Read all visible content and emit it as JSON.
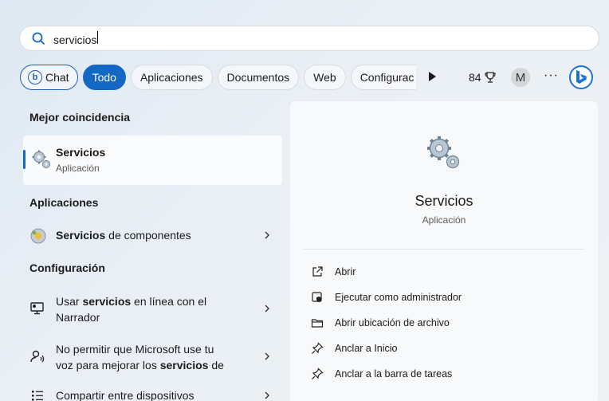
{
  "search": {
    "value": "servicios"
  },
  "filters": [
    {
      "label": "Chat"
    },
    {
      "label": "Todo"
    },
    {
      "label": "Aplicaciones"
    },
    {
      "label": "Documentos"
    },
    {
      "label": "Web"
    },
    {
      "label": "Configurac"
    }
  ],
  "toolbar": {
    "points": "84",
    "avatar_initial": "M",
    "more": "···"
  },
  "left": {
    "best_match_title": "Mejor coincidencia",
    "best": {
      "name": "Servicios",
      "type": "Aplicación"
    },
    "apps_title": "Aplicaciones",
    "app_item": {
      "bold": "Servicios",
      "rest": " de componentes"
    },
    "config_title": "Configuración",
    "config_items": [
      {
        "pre": "Usar ",
        "bold": "servicios",
        "post": " en línea con el Narrador"
      },
      {
        "pre": "No permitir que Microsoft use tu voz para mejorar los ",
        "bold": "servicios",
        "post": " de"
      },
      {
        "pre": "Compartir entre dispositivos",
        "bold": "",
        "post": ""
      }
    ]
  },
  "right": {
    "title": "Servicios",
    "subtitle": "Aplicación",
    "actions": [
      {
        "label": "Abrir",
        "icon": "open-icon"
      },
      {
        "label": "Ejecutar como administrador",
        "icon": "shield-icon"
      },
      {
        "label": "Abrir ubicación de archivo",
        "icon": "folder-icon"
      },
      {
        "label": "Anclar a Inicio",
        "icon": "pin-icon"
      },
      {
        "label": "Anclar a la barra de tareas",
        "icon": "pin-icon"
      }
    ]
  },
  "colors": {
    "accent": "#1368c4",
    "bing": "#1a74d8"
  }
}
